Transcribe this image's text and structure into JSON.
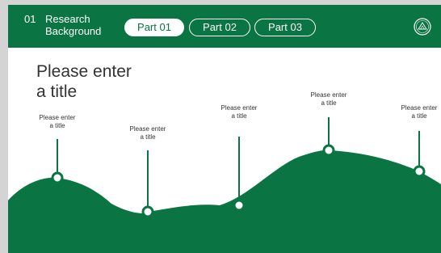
{
  "header": {
    "section_number": "01",
    "section_title_line1": "Research",
    "section_title_line2": "Background",
    "tabs": [
      {
        "label": "Part 01",
        "active": true
      },
      {
        "label": "Part 02",
        "active": false
      },
      {
        "label": "Part 03",
        "active": false
      }
    ],
    "logo_icon": "emblem-icon"
  },
  "main": {
    "title_line1": "Please enter",
    "title_line2": "a title"
  },
  "points": [
    {
      "line1": "Please enter",
      "line2": "a title"
    },
    {
      "line1": "Please enter",
      "line2": "a title"
    },
    {
      "line1": "Please enter",
      "line2": "a title"
    },
    {
      "line1": "Please enter",
      "line2": "a title"
    },
    {
      "line1": "Please enter",
      "line2": "a title"
    }
  ],
  "colors": {
    "brand_green": "#0a7442",
    "page_bg": "#d4d4d4"
  }
}
